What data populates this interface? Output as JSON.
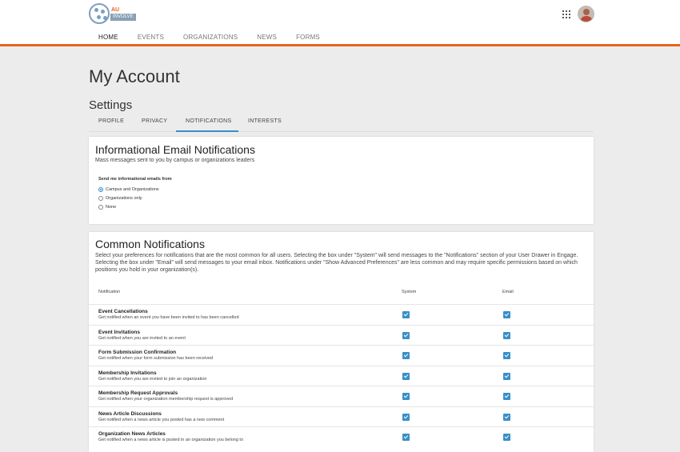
{
  "header": {
    "logo": {
      "top": "AU",
      "bottom": "INVOLVE"
    },
    "apps_icon": "grid-apps-icon",
    "avatar": "user-avatar"
  },
  "nav": [
    "HOME",
    "EVENTS",
    "ORGANIZATIONS",
    "NEWS",
    "FORMS"
  ],
  "page_title": "My Account",
  "settings_title": "Settings",
  "tabs": [
    "PROFILE",
    "PRIVACY",
    "NOTIFICATIONS",
    "INTERESTS"
  ],
  "info": {
    "title": "Informational Email Notifications",
    "subtitle": "Mass messages sent to you by campus or organizations leaders",
    "send_label": "Send me informational emails from",
    "options": [
      "Campus and Organizations",
      "Organizations only",
      "None"
    ],
    "selected": 0
  },
  "common": {
    "title": "Common Notifications",
    "description": "Select your preferences for notifications that are the most common for all users. Selecting the box under \"System\" will send messages to the \"Notifications\" section of your User Drawer in Engage. Selecting the box under \"Email\" will send messages to your email inbox. Notifications under \"Show Advanced Preferences\" are less common and may require specific permissions based on which positions you hold in your organization(s).",
    "col_notification": "Notification",
    "col_system": "System",
    "col_email": "Email",
    "rows": [
      {
        "title": "Event Cancellations",
        "desc": "Get notified when an event you have been invited to has been cancelled",
        "system": true,
        "email": true
      },
      {
        "title": "Event Invitations",
        "desc": "Get notified when you are invited to an event",
        "system": true,
        "email": true
      },
      {
        "title": "Form Submission Confirmation",
        "desc": "Get notified when your form submission has been received",
        "system": true,
        "email": true
      },
      {
        "title": "Membership Invitations",
        "desc": "Get notified when you are invited to join an organization",
        "system": true,
        "email": true
      },
      {
        "title": "Membership Request Approvals",
        "desc": "Get notified when your organization membership request is approved",
        "system": true,
        "email": true
      },
      {
        "title": "News Article Discussions",
        "desc": "Get notified when a news article you posted has a new comment",
        "system": true,
        "email": true
      },
      {
        "title": "Organization News Articles",
        "desc": "Get notified when a news article is posted in an organization you belong to",
        "system": true,
        "email": true
      }
    ]
  },
  "colors": {
    "accent": "#e8631d",
    "primary": "#3a8fc7"
  }
}
